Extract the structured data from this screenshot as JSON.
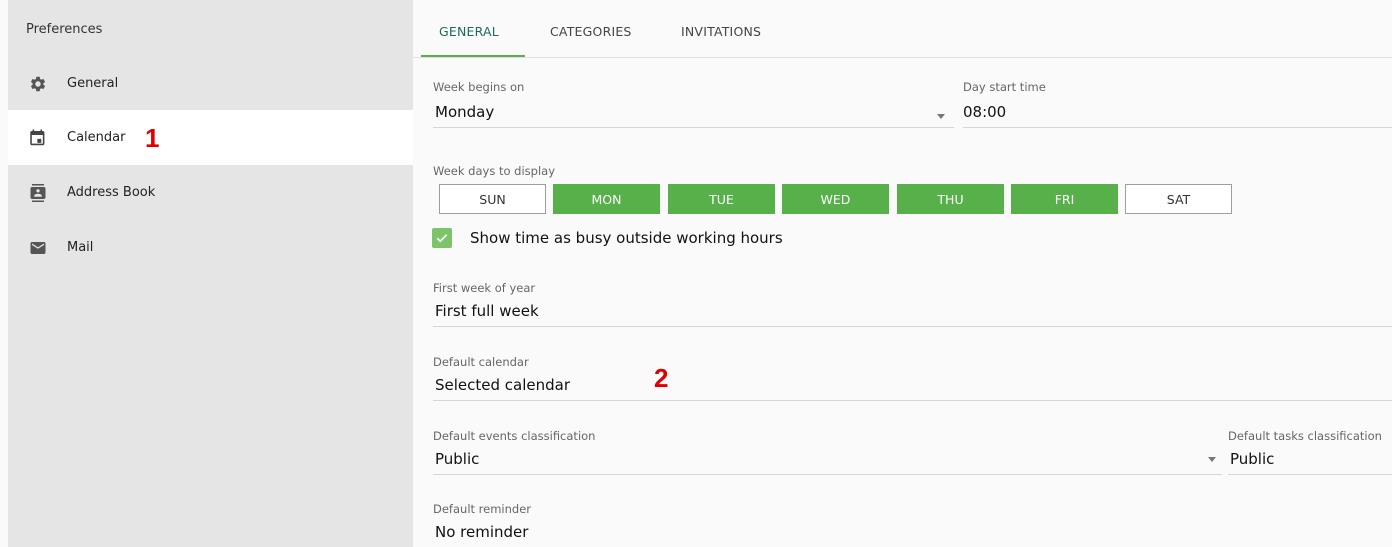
{
  "sidebar": {
    "title": "Preferences",
    "items": [
      {
        "label": "General",
        "icon": "gear-icon"
      },
      {
        "label": "Calendar",
        "icon": "calendar-icon",
        "active": true
      },
      {
        "label": "Address Book",
        "icon": "address-book-icon"
      },
      {
        "label": "Mail",
        "icon": "mail-icon"
      }
    ]
  },
  "annotations": [
    "1",
    "2"
  ],
  "tabs": [
    {
      "label": "GENERAL",
      "active": true
    },
    {
      "label": "CATEGORIES"
    },
    {
      "label": "INVITATIONS"
    }
  ],
  "form": {
    "week_begins": {
      "label": "Week begins on",
      "value": "Monday"
    },
    "day_start": {
      "label": "Day start time",
      "value": "08:00"
    },
    "week_days": {
      "label": "Week days to display",
      "days": [
        {
          "label": "SUN",
          "selected": false
        },
        {
          "label": "MON",
          "selected": true
        },
        {
          "label": "TUE",
          "selected": true
        },
        {
          "label": "WED",
          "selected": true
        },
        {
          "label": "THU",
          "selected": true
        },
        {
          "label": "FRI",
          "selected": true
        },
        {
          "label": "SAT",
          "selected": false
        }
      ]
    },
    "busy_outside": {
      "label": "Show time as busy outside working hours",
      "checked": true
    },
    "first_week": {
      "label": "First week of year",
      "value": "First full week"
    },
    "default_calendar": {
      "label": "Default calendar",
      "value": "Selected calendar"
    },
    "events_class": {
      "label": "Default events classification",
      "value": "Public"
    },
    "tasks_class": {
      "label": "Default tasks classification",
      "value": "Public"
    },
    "reminder": {
      "label": "Default reminder",
      "value": "No reminder"
    }
  },
  "colors": {
    "accent": "#58b04b",
    "tab_active": "#1a6b5b",
    "annotation": "#e00000"
  }
}
